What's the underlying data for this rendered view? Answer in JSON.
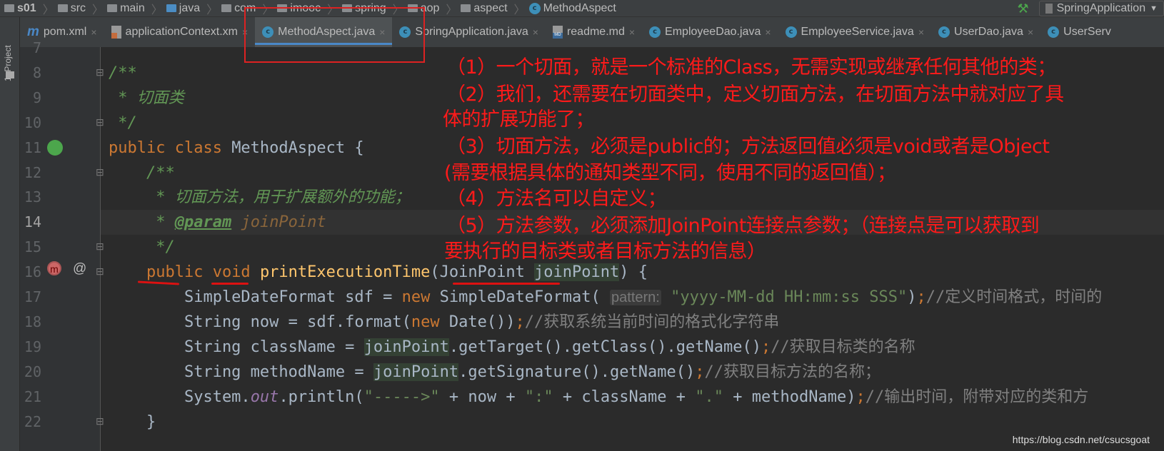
{
  "breadcrumb": [
    "s01",
    "src",
    "main",
    "java",
    "com",
    "imooc",
    "spring",
    "aop",
    "aspect",
    "MethodAspect"
  ],
  "run_config": "SpringApplication",
  "side_panel": "1: Project",
  "tabs": [
    {
      "label": "pom.xml",
      "icon": "maven-icon"
    },
    {
      "label": "applicationContext.xm",
      "icon": "xml-file-icon"
    },
    {
      "label": "MethodAspect.java",
      "icon": "class-icon",
      "active": true
    },
    {
      "label": "SpringApplication.java",
      "icon": "class-icon"
    },
    {
      "label": "readme.md",
      "icon": "markdown-icon"
    },
    {
      "label": "EmployeeDao.java",
      "icon": "class-icon"
    },
    {
      "label": "EmployeeService.java",
      "icon": "class-icon"
    },
    {
      "label": "UserDao.java",
      "icon": "class-icon"
    },
    {
      "label": "UserServ",
      "icon": "class-icon"
    }
  ],
  "current_line": 14,
  "code": [
    {
      "n": 7,
      "t": []
    },
    {
      "n": 8,
      "t": [
        [
          "doc",
          "/**"
        ]
      ]
    },
    {
      "n": 9,
      "t": [
        [
          "doc",
          " * 切面类"
        ]
      ]
    },
    {
      "n": 10,
      "t": [
        [
          "doc",
          " */"
        ]
      ]
    },
    {
      "n": 11,
      "t": [
        [
          "kw",
          "public class "
        ],
        [
          "",
          "MethodAspect {"
        ]
      ]
    },
    {
      "n": 12,
      "t": [
        [
          "doc",
          "    /**"
        ]
      ]
    },
    {
      "n": 13,
      "t": [
        [
          "doc",
          "     * 切面方法，用于扩展额外的功能；"
        ]
      ]
    },
    {
      "n": 14,
      "t": [
        [
          "doc",
          "     * "
        ],
        [
          "tag",
          "@param"
        ],
        [
          "doc",
          " "
        ],
        [
          "dparam",
          "joinPoint"
        ]
      ]
    },
    {
      "n": 15,
      "t": [
        [
          "doc",
          "     */"
        ]
      ]
    },
    {
      "n": 16,
      "t": [
        [
          "",
          "    "
        ],
        [
          "kw",
          "public void "
        ],
        [
          "fn",
          "printExecutionTime"
        ],
        [
          "",
          "(JoinPoint "
        ],
        [
          "hl",
          "joinPoint"
        ],
        [
          "",
          ") {"
        ]
      ]
    },
    {
      "n": 17,
      "t": [
        [
          "",
          "        SimpleDateFormat sdf = "
        ],
        [
          "kw",
          "new "
        ],
        [
          "",
          "SimpleDateFormat( "
        ],
        [
          "hint",
          "pattern:"
        ],
        [
          "str",
          " \"yyyy-MM-dd HH:mm:ss SSS\""
        ],
        [
          "",
          ")"
        ],
        [
          "kw",
          ";"
        ],
        [
          "cm",
          "//定义时间格式，时间的"
        ]
      ]
    },
    {
      "n": 18,
      "t": [
        [
          "",
          "        String now = sdf.format("
        ],
        [
          "kw",
          "new "
        ],
        [
          "",
          "Date())"
        ],
        [
          "kw",
          ";"
        ],
        [
          "cm",
          "//获取系统当前时间的格式化字符串"
        ]
      ]
    },
    {
      "n": 19,
      "t": [
        [
          "",
          "        String className = "
        ],
        [
          "hl",
          "joinPoint"
        ],
        [
          "",
          ".getTarget().getClass().getName()"
        ],
        [
          "kw",
          ";"
        ],
        [
          "cm",
          "//获取目标类的名称"
        ]
      ]
    },
    {
      "n": 20,
      "t": [
        [
          "",
          "        String methodName = "
        ],
        [
          "hl",
          "joinPoint"
        ],
        [
          "",
          ".getSignature().getName()"
        ],
        [
          "kw",
          ";"
        ],
        [
          "cm",
          "//获取目标方法的名称；"
        ]
      ]
    },
    {
      "n": 21,
      "t": [
        [
          "",
          "        System."
        ],
        [
          "st",
          "out"
        ],
        [
          "",
          ".println("
        ],
        [
          "str",
          "\"----->\""
        ],
        [
          "",
          " + now + "
        ],
        [
          "str",
          "\":\""
        ],
        [
          "",
          " + className + "
        ],
        [
          "str",
          "\".\""
        ],
        [
          "",
          " + methodName)"
        ],
        [
          "kw",
          ";"
        ],
        [
          "cm",
          "//输出时间，附带对应的类和方"
        ]
      ]
    },
    {
      "n": 22,
      "t": [
        [
          "",
          "    }"
        ]
      ]
    }
  ],
  "annotations": [
    "（1）一个切面，就是一个标准的Class，无需实现或继承任何其他的类；",
    "（2）我们，还需要在切面类中，定义切面方法，在切面方法中就对应了具",
    "体的扩展功能了；",
    "（3）切面方法，必须是public的；方法返回值必须是void或者是Object",
    "(需要根据具体的通知类型不同，使用不同的返回值）；",
    "（4）方法名可以自定义；",
    "（5）方法参数，必须添加JoinPoint连接点参数；（连接点是可以获取到",
    "要执行的目标类或者目标方法的信息）"
  ],
  "watermark": "https://blog.csdn.net/csucsgoat"
}
